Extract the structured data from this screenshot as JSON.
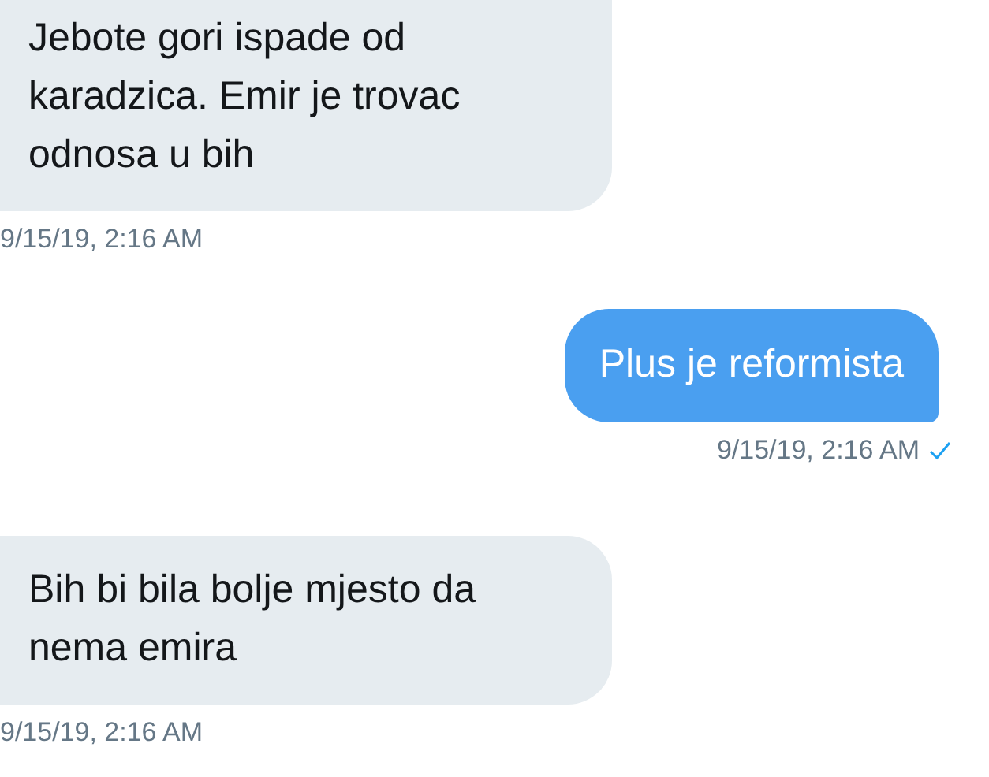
{
  "messages": [
    {
      "kind": "received",
      "text": "Jebote gori ispade od karadzica. Emir je trovac odnosa u bih",
      "time": "9/15/19, 2:16 AM"
    },
    {
      "kind": "sent",
      "text": "Plus je reformista",
      "time": "9/15/19, 2:16 AM",
      "read": true
    },
    {
      "kind": "received",
      "text": "Bih bi bila bolje mjesto da nema emira",
      "time": "9/15/19, 2:16 AM"
    }
  ]
}
